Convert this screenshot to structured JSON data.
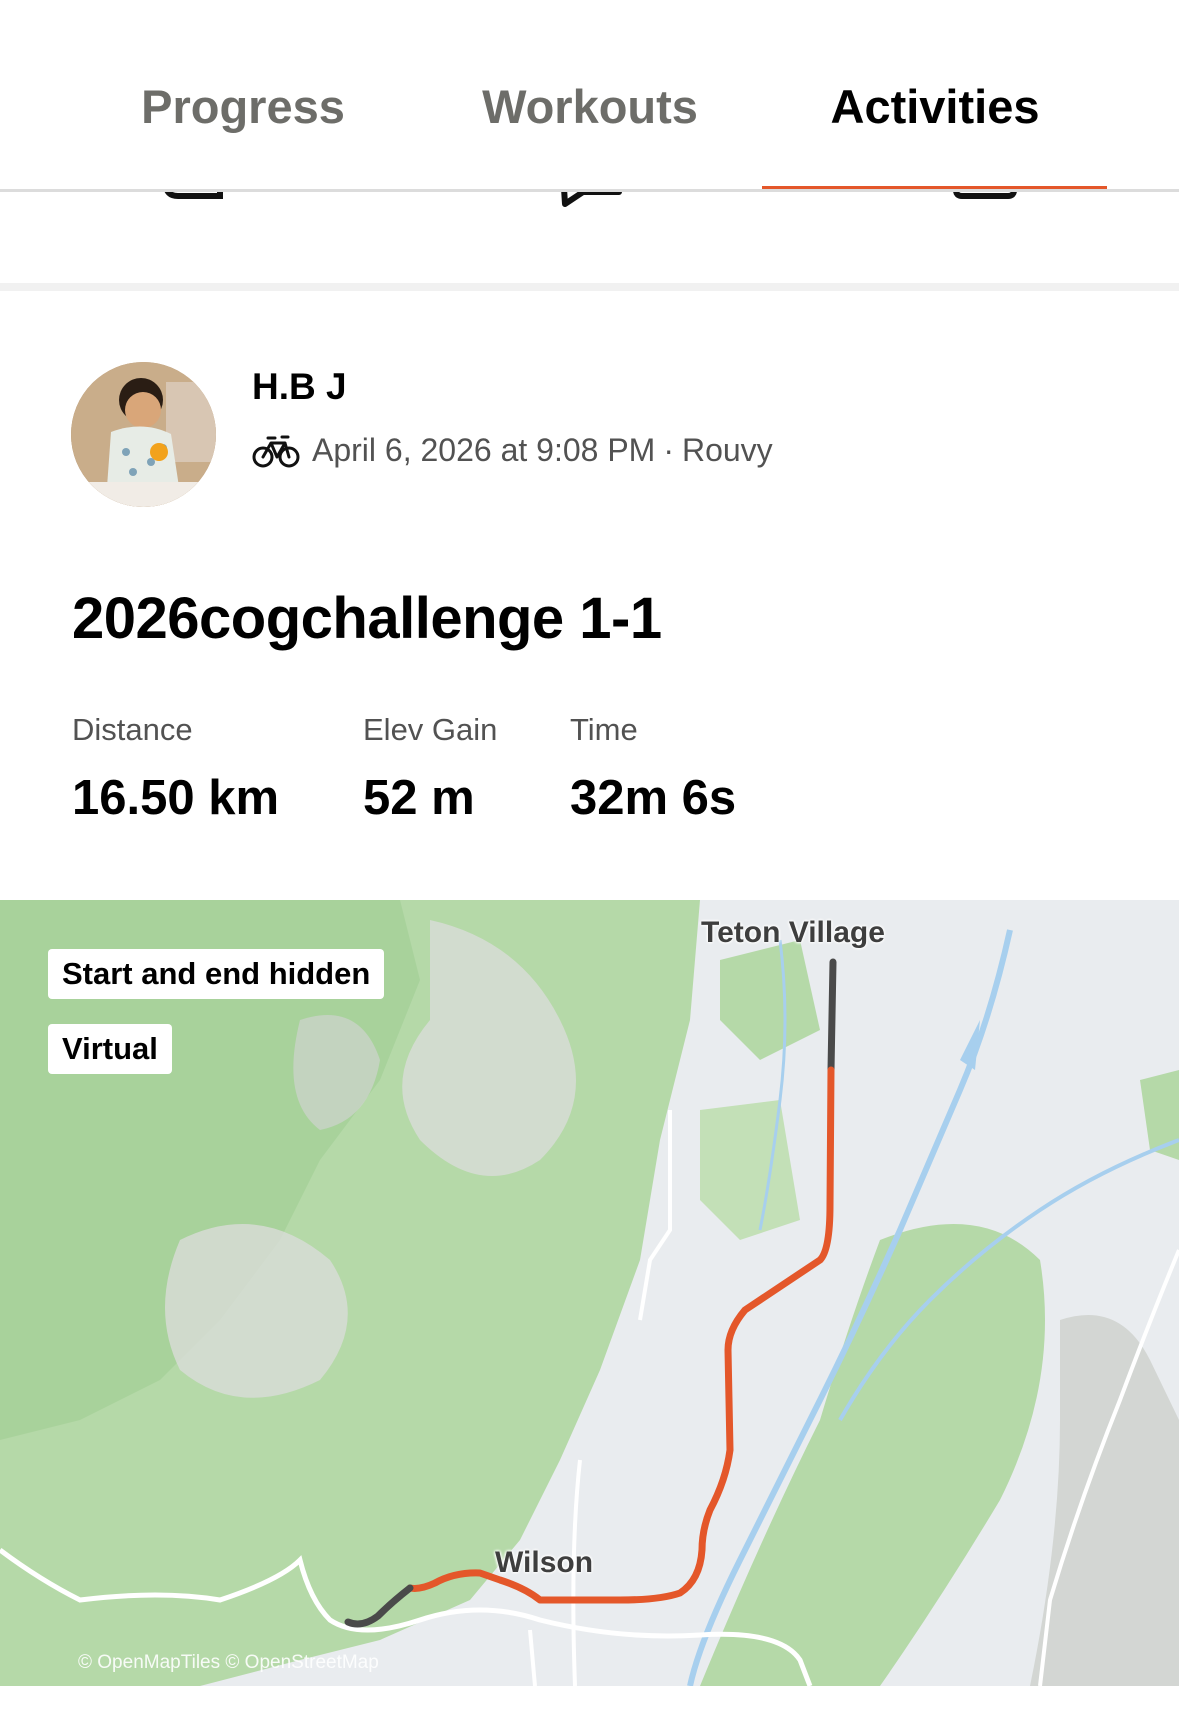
{
  "tabs": [
    {
      "label": "Progress",
      "active": false
    },
    {
      "label": "Workouts",
      "active": false
    },
    {
      "label": "Activities",
      "active": true
    }
  ],
  "colors": {
    "accent": "#e4572a",
    "route": "#e4572a",
    "route_hidden": "#4a4a4a",
    "map_green": "#b5d9a8"
  },
  "activity": {
    "athlete_name": "H.B J",
    "sport_icon": "bike-icon",
    "date": "April 6, 2026 at 9:08 PM",
    "separator": "·",
    "source": "Rouvy",
    "title": "2026cogchallenge 1-1",
    "stats": [
      {
        "label": "Distance",
        "value": "16.50 km"
      },
      {
        "label": "Elev Gain",
        "value": "52 m"
      },
      {
        "label": "Time",
        "value": "32m 6s"
      }
    ]
  },
  "map": {
    "badges": [
      "Start and end hidden",
      "Virtual"
    ],
    "places": [
      "Teton Village",
      "Wilson"
    ],
    "attribution": "© OpenMapTiles © OpenStreetMap"
  }
}
